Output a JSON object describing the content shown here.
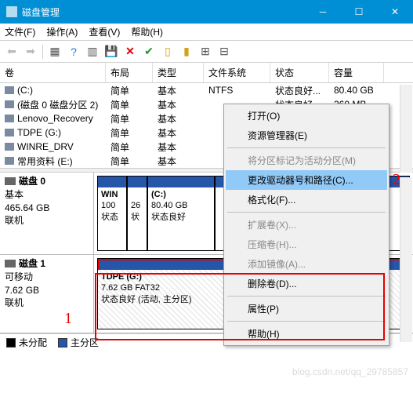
{
  "window": {
    "title": "磁盘管理"
  },
  "menubar": [
    "文件(F)",
    "操作(A)",
    "查看(V)",
    "帮助(H)"
  ],
  "columns": {
    "vol": "卷",
    "layout": "布局",
    "type": "类型",
    "fs": "文件系统",
    "status": "状态",
    "cap": "容量"
  },
  "volumes": [
    {
      "name": "(C:)",
      "layout": "简单",
      "type": "基本",
      "fs": "NTFS",
      "status": "状态良好...",
      "cap": "80.40 GB"
    },
    {
      "name": "(磁盘 0 磁盘分区 2)",
      "layout": "简单",
      "type": "基本",
      "fs": "",
      "status": "状态良好...",
      "cap": "260 MB"
    },
    {
      "name": "Lenovo_Recovery",
      "layout": "简单",
      "type": "基本",
      "fs": "",
      "status": "",
      "cap": ""
    },
    {
      "name": "TDPE (G:)",
      "layout": "简单",
      "type": "基本",
      "fs": "",
      "status": "",
      "cap": ""
    },
    {
      "name": "WINRE_DRV",
      "layout": "简单",
      "type": "基本",
      "fs": "",
      "status": "",
      "cap": ""
    },
    {
      "name": "常用资料 (E:)",
      "layout": "简单",
      "type": "基本",
      "fs": "",
      "status": "",
      "cap": ""
    }
  ],
  "disk0": {
    "title": "磁盘 0",
    "type": "基本",
    "size": "465.64 GB",
    "state": "联机",
    "parts": [
      {
        "label": "WIN",
        "line2": "100",
        "line3": "状态"
      },
      {
        "label": "",
        "line2": "26",
        "line3": "状"
      },
      {
        "label": "(C:)",
        "line2": "80.40 GB",
        "line3": "状态良好"
      }
    ]
  },
  "disk1": {
    "title": "磁盘 1",
    "type": "可移动",
    "size": "7.62 GB",
    "state": "联机",
    "part": {
      "label": "TDPE  (G:)",
      "line2": "7.62 GB FAT32",
      "line3": "状态良好 (活动, 主分区)"
    }
  },
  "legend": {
    "unalloc": "未分配",
    "primary": "主分区"
  },
  "context_menu": [
    {
      "label": "打开(O)",
      "enabled": true
    },
    {
      "label": "资源管理器(E)",
      "enabled": true
    },
    {
      "sep": true
    },
    {
      "label": "将分区标记为活动分区(M)",
      "enabled": false
    },
    {
      "label": "更改驱动器号和路径(C)...",
      "enabled": true,
      "hl": true
    },
    {
      "label": "格式化(F)...",
      "enabled": true
    },
    {
      "sep": true
    },
    {
      "label": "扩展卷(X)...",
      "enabled": false
    },
    {
      "label": "压缩卷(H)...",
      "enabled": false
    },
    {
      "label": "添加镜像(A)...",
      "enabled": false
    },
    {
      "label": "删除卷(D)...",
      "enabled": true
    },
    {
      "sep": true
    },
    {
      "label": "属性(P)",
      "enabled": true
    },
    {
      "sep": true
    },
    {
      "label": "帮助(H)",
      "enabled": true
    }
  ],
  "annotations": {
    "one": "1",
    "two": "2"
  },
  "watermark": "blog.csdn.net/qq_29785857"
}
